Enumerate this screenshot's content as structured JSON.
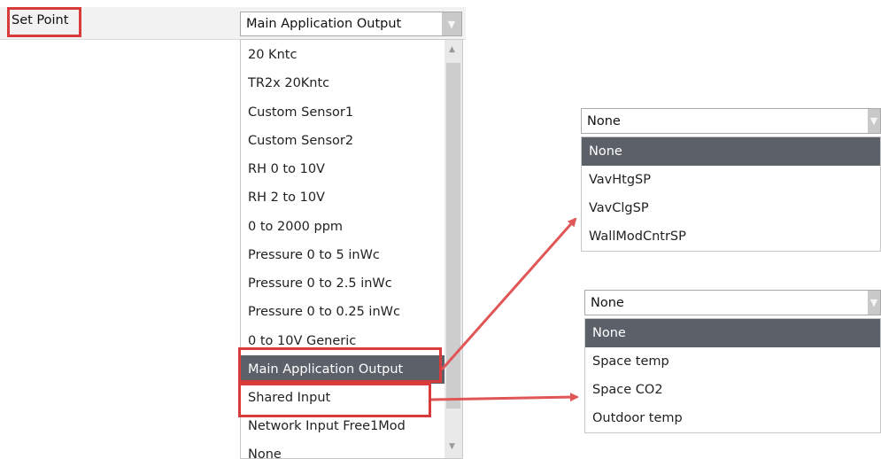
{
  "setpoint": {
    "label": "Set Point"
  },
  "main_select": {
    "value": "Main Application Output",
    "options": [
      "20 Kntc",
      "TR2x 20Kntc",
      "Custom Sensor1",
      "Custom Sensor2",
      "RH 0 to 10V",
      "RH 2 to 10V",
      "0 to 2000 ppm",
      "Pressure 0 to 5 inWc",
      "Pressure 0 to 2.5 inWc",
      "Pressure 0 to 0.25 inWc",
      "0 to 10V Generic",
      "Main Application Output",
      "Shared Input",
      "Network Input Free1Mod",
      "None"
    ],
    "selected": "Main Application Output"
  },
  "app_output_select": {
    "value": "None",
    "options": [
      "None",
      "VavHtgSP",
      "VavClgSP",
      "WallModCntrSP"
    ],
    "selected": "None"
  },
  "shared_input_select": {
    "value": "None",
    "options": [
      "None",
      "Space temp",
      "Space CO2",
      "Outdoor temp"
    ],
    "selected": "None"
  },
  "colors": {
    "highlight": "#d93a3a",
    "selected_bg": "#5c6169",
    "arrow": "#e05555"
  }
}
